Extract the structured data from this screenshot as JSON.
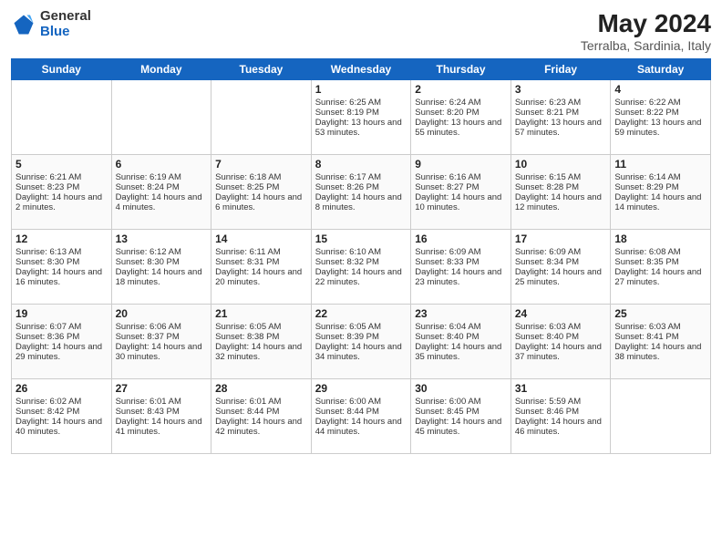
{
  "logo": {
    "general": "General",
    "blue": "Blue"
  },
  "calendar": {
    "title": "May 2024",
    "subtitle": "Terralba, Sardinia, Italy",
    "headers": [
      "Sunday",
      "Monday",
      "Tuesday",
      "Wednesday",
      "Thursday",
      "Friday",
      "Saturday"
    ],
    "weeks": [
      [
        {
          "day": "",
          "empty": true
        },
        {
          "day": "",
          "empty": true
        },
        {
          "day": "",
          "empty": true
        },
        {
          "day": "1",
          "sunrise": "Sunrise: 6:25 AM",
          "sunset": "Sunset: 8:19 PM",
          "daylight": "Daylight: 13 hours and 53 minutes."
        },
        {
          "day": "2",
          "sunrise": "Sunrise: 6:24 AM",
          "sunset": "Sunset: 8:20 PM",
          "daylight": "Daylight: 13 hours and 55 minutes."
        },
        {
          "day": "3",
          "sunrise": "Sunrise: 6:23 AM",
          "sunset": "Sunset: 8:21 PM",
          "daylight": "Daylight: 13 hours and 57 minutes."
        },
        {
          "day": "4",
          "sunrise": "Sunrise: 6:22 AM",
          "sunset": "Sunset: 8:22 PM",
          "daylight": "Daylight: 13 hours and 59 minutes."
        }
      ],
      [
        {
          "day": "5",
          "sunrise": "Sunrise: 6:21 AM",
          "sunset": "Sunset: 8:23 PM",
          "daylight": "Daylight: 14 hours and 2 minutes."
        },
        {
          "day": "6",
          "sunrise": "Sunrise: 6:19 AM",
          "sunset": "Sunset: 8:24 PM",
          "daylight": "Daylight: 14 hours and 4 minutes."
        },
        {
          "day": "7",
          "sunrise": "Sunrise: 6:18 AM",
          "sunset": "Sunset: 8:25 PM",
          "daylight": "Daylight: 14 hours and 6 minutes."
        },
        {
          "day": "8",
          "sunrise": "Sunrise: 6:17 AM",
          "sunset": "Sunset: 8:26 PM",
          "daylight": "Daylight: 14 hours and 8 minutes."
        },
        {
          "day": "9",
          "sunrise": "Sunrise: 6:16 AM",
          "sunset": "Sunset: 8:27 PM",
          "daylight": "Daylight: 14 hours and 10 minutes."
        },
        {
          "day": "10",
          "sunrise": "Sunrise: 6:15 AM",
          "sunset": "Sunset: 8:28 PM",
          "daylight": "Daylight: 14 hours and 12 minutes."
        },
        {
          "day": "11",
          "sunrise": "Sunrise: 6:14 AM",
          "sunset": "Sunset: 8:29 PM",
          "daylight": "Daylight: 14 hours and 14 minutes."
        }
      ],
      [
        {
          "day": "12",
          "sunrise": "Sunrise: 6:13 AM",
          "sunset": "Sunset: 8:30 PM",
          "daylight": "Daylight: 14 hours and 16 minutes."
        },
        {
          "day": "13",
          "sunrise": "Sunrise: 6:12 AM",
          "sunset": "Sunset: 8:30 PM",
          "daylight": "Daylight: 14 hours and 18 minutes."
        },
        {
          "day": "14",
          "sunrise": "Sunrise: 6:11 AM",
          "sunset": "Sunset: 8:31 PM",
          "daylight": "Daylight: 14 hours and 20 minutes."
        },
        {
          "day": "15",
          "sunrise": "Sunrise: 6:10 AM",
          "sunset": "Sunset: 8:32 PM",
          "daylight": "Daylight: 14 hours and 22 minutes."
        },
        {
          "day": "16",
          "sunrise": "Sunrise: 6:09 AM",
          "sunset": "Sunset: 8:33 PM",
          "daylight": "Daylight: 14 hours and 23 minutes."
        },
        {
          "day": "17",
          "sunrise": "Sunrise: 6:09 AM",
          "sunset": "Sunset: 8:34 PM",
          "daylight": "Daylight: 14 hours and 25 minutes."
        },
        {
          "day": "18",
          "sunrise": "Sunrise: 6:08 AM",
          "sunset": "Sunset: 8:35 PM",
          "daylight": "Daylight: 14 hours and 27 minutes."
        }
      ],
      [
        {
          "day": "19",
          "sunrise": "Sunrise: 6:07 AM",
          "sunset": "Sunset: 8:36 PM",
          "daylight": "Daylight: 14 hours and 29 minutes."
        },
        {
          "day": "20",
          "sunrise": "Sunrise: 6:06 AM",
          "sunset": "Sunset: 8:37 PM",
          "daylight": "Daylight: 14 hours and 30 minutes."
        },
        {
          "day": "21",
          "sunrise": "Sunrise: 6:05 AM",
          "sunset": "Sunset: 8:38 PM",
          "daylight": "Daylight: 14 hours and 32 minutes."
        },
        {
          "day": "22",
          "sunrise": "Sunrise: 6:05 AM",
          "sunset": "Sunset: 8:39 PM",
          "daylight": "Daylight: 14 hours and 34 minutes."
        },
        {
          "day": "23",
          "sunrise": "Sunrise: 6:04 AM",
          "sunset": "Sunset: 8:40 PM",
          "daylight": "Daylight: 14 hours and 35 minutes."
        },
        {
          "day": "24",
          "sunrise": "Sunrise: 6:03 AM",
          "sunset": "Sunset: 8:40 PM",
          "daylight": "Daylight: 14 hours and 37 minutes."
        },
        {
          "day": "25",
          "sunrise": "Sunrise: 6:03 AM",
          "sunset": "Sunset: 8:41 PM",
          "daylight": "Daylight: 14 hours and 38 minutes."
        }
      ],
      [
        {
          "day": "26",
          "sunrise": "Sunrise: 6:02 AM",
          "sunset": "Sunset: 8:42 PM",
          "daylight": "Daylight: 14 hours and 40 minutes."
        },
        {
          "day": "27",
          "sunrise": "Sunrise: 6:01 AM",
          "sunset": "Sunset: 8:43 PM",
          "daylight": "Daylight: 14 hours and 41 minutes."
        },
        {
          "day": "28",
          "sunrise": "Sunrise: 6:01 AM",
          "sunset": "Sunset: 8:44 PM",
          "daylight": "Daylight: 14 hours and 42 minutes."
        },
        {
          "day": "29",
          "sunrise": "Sunrise: 6:00 AM",
          "sunset": "Sunset: 8:44 PM",
          "daylight": "Daylight: 14 hours and 44 minutes."
        },
        {
          "day": "30",
          "sunrise": "Sunrise: 6:00 AM",
          "sunset": "Sunset: 8:45 PM",
          "daylight": "Daylight: 14 hours and 45 minutes."
        },
        {
          "day": "31",
          "sunrise": "Sunrise: 5:59 AM",
          "sunset": "Sunset: 8:46 PM",
          "daylight": "Daylight: 14 hours and 46 minutes."
        },
        {
          "day": "",
          "empty": true
        }
      ]
    ]
  }
}
